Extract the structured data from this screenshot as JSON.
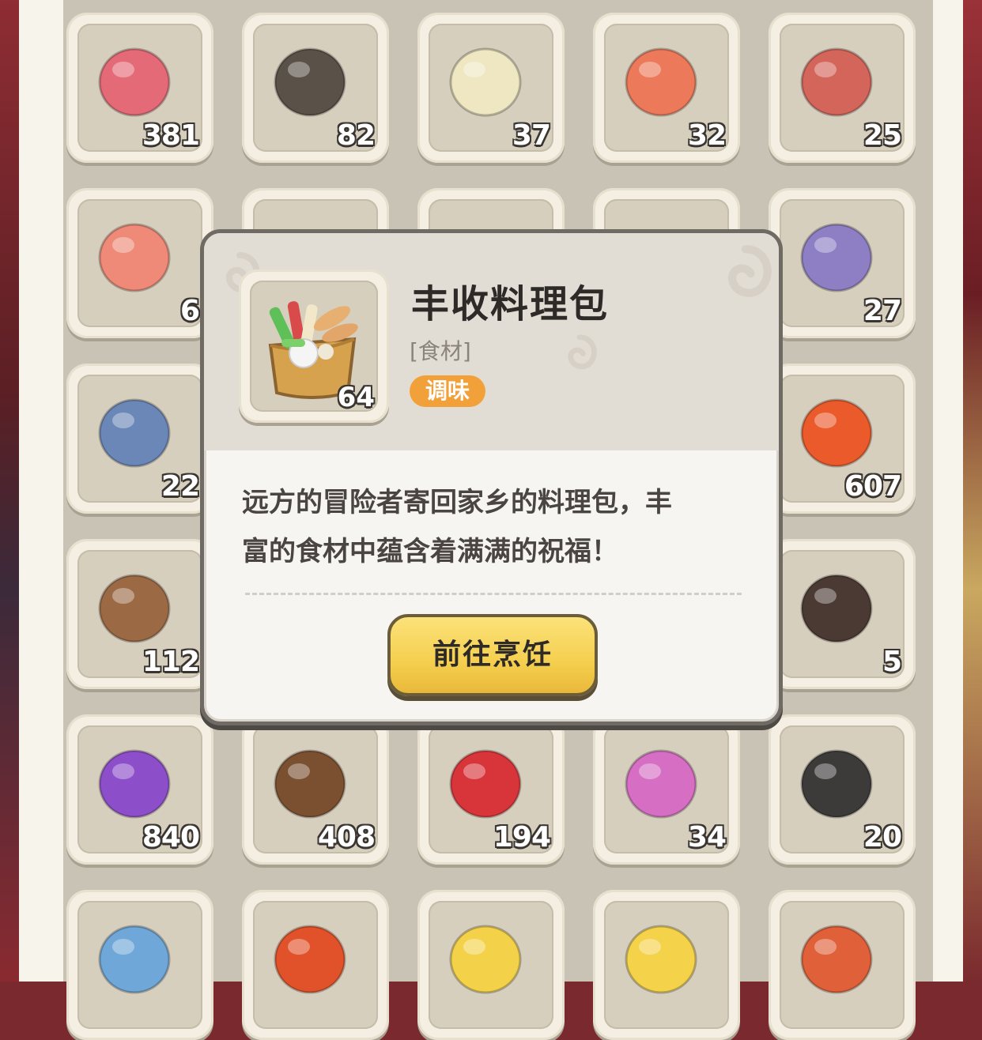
{
  "inventory": {
    "rows": [
      [
        {
          "name": "ribs-icon",
          "count": "381",
          "color": "#e46a77"
        },
        {
          "name": "ore-icon",
          "count": "82",
          "color": "#5a5148"
        },
        {
          "name": "egg-icon",
          "count": "37",
          "color": "#efe7c2"
        },
        {
          "name": "ham-icon",
          "count": "32",
          "color": "#ec7a5a"
        },
        {
          "name": "spare-ribs-icon",
          "count": "25",
          "color": "#d4655b"
        }
      ],
      [
        {
          "name": "drumstick-icon",
          "count": "6",
          "color": "#ef8a78"
        },
        {
          "name": "hidden-item-icon",
          "count": "",
          "color": "#c97a53"
        },
        {
          "name": "hidden-item-icon",
          "count": "",
          "color": "#4f5fb8"
        },
        {
          "name": "hidden-item-icon",
          "count": "",
          "color": "#a43a4a"
        },
        {
          "name": "octopus-icon",
          "count": "27",
          "color": "#8e7fc4"
        }
      ],
      [
        {
          "name": "swordfish-icon",
          "count": "22",
          "color": "#6b87b7"
        },
        {
          "name": "hidden-item-icon",
          "count": "",
          "color": "#cccccc"
        },
        {
          "name": "hidden-item-icon",
          "count": "",
          "color": "#cccccc"
        },
        {
          "name": "hidden-item-icon",
          "count": "",
          "color": "#cccccc"
        },
        {
          "name": "tomato-icon",
          "count": "607",
          "color": "#ea5a2a"
        }
      ],
      [
        {
          "name": "mushroom-icon",
          "count": "112",
          "color": "#9b6a45"
        },
        {
          "name": "hidden-item-icon",
          "count": "",
          "color": "#cccccc"
        },
        {
          "name": "hidden-item-icon",
          "count": "",
          "color": "#cccccc"
        },
        {
          "name": "hidden-item-icon",
          "count": "",
          "color": "#cccccc"
        },
        {
          "name": "truffle-icon",
          "count": "5",
          "color": "#4b3a33"
        }
      ],
      [
        {
          "name": "grape-icon",
          "count": "840",
          "color": "#8c4ec9"
        },
        {
          "name": "coconut-icon",
          "count": "408",
          "color": "#7a5030"
        },
        {
          "name": "pomegranate-icon",
          "count": "194",
          "color": "#d8353a"
        },
        {
          "name": "tentacle-icon",
          "count": "34",
          "color": "#d66fc4"
        },
        {
          "name": "fang-icon",
          "count": "20",
          "color": "#3d3a3a"
        }
      ],
      [
        {
          "name": "crystal-heart-icon",
          "count": "",
          "color": "#6fa7d8"
        },
        {
          "name": "apple-icon",
          "count": "",
          "color": "#e2522a"
        },
        {
          "name": "pineapple-icon",
          "count": "",
          "color": "#f3d24a"
        },
        {
          "name": "cheese-icon",
          "count": "",
          "color": "#f4d24a"
        },
        {
          "name": "herb-leaf-icon",
          "count": "",
          "color": "#e0603a"
        }
      ]
    ]
  },
  "popup": {
    "icon": "harvest-cooking-pack-icon",
    "count": "64",
    "title": "丰收料理包",
    "category": "[食材]",
    "tag": "调味",
    "description_line1": "远方的冒险者寄回家乡的料理包，丰",
    "description_line2": "富的食材中蕴含着满满的祝福！",
    "button_label": "前往烹饪",
    "accent_color": "#f2a13a",
    "button_color": "#f5cf4e"
  }
}
